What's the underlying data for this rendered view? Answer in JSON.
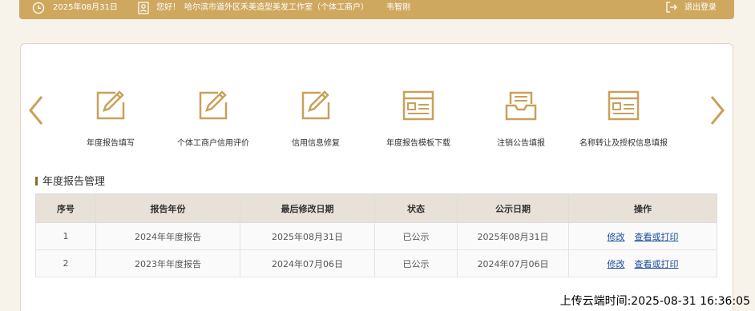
{
  "topbar": {
    "date": "2025年08月31日",
    "greeting": "您好！",
    "company": "哈尔滨市道外区禾美造型美发工作室（个体工商户）",
    "user": "韦智刚",
    "logout": "退出登录"
  },
  "services": [
    {
      "label": "年度报告填写",
      "icon": "edit-icon"
    },
    {
      "label": "个体工商户信用评价",
      "icon": "edit-icon"
    },
    {
      "label": "信用信息修复",
      "icon": "edit-icon"
    },
    {
      "label": "年度报告模板下载",
      "icon": "template-icon"
    },
    {
      "label": "注销公告填报",
      "icon": "inbox-icon"
    },
    {
      "label": "名称转让及授权信息填报",
      "icon": "template-icon"
    }
  ],
  "section": {
    "title": "年度报告管理"
  },
  "table": {
    "headers": [
      "序号",
      "报告年份",
      "最后修改日期",
      "状态",
      "公示日期",
      "操作"
    ],
    "rows": [
      {
        "no": "1",
        "year": "2024年年度报告",
        "modified": "2025年08月31日",
        "status": "已公示",
        "published": "2025年08月31日",
        "action_edit": "修改",
        "action_view": "查看或打印"
      },
      {
        "no": "2",
        "year": "2023年年度报告",
        "modified": "2024年07月06日",
        "status": "已公示",
        "published": "2024年07月06日",
        "action_edit": "修改",
        "action_view": "查看或打印"
      }
    ]
  },
  "upload_time": "上传云端时间:2025-08-31 16:36:05",
  "colors": {
    "accent": "#cfa85f",
    "icon": "#c9a15a",
    "header_bg": "#e8e1d7",
    "link": "#1b4d9c"
  }
}
